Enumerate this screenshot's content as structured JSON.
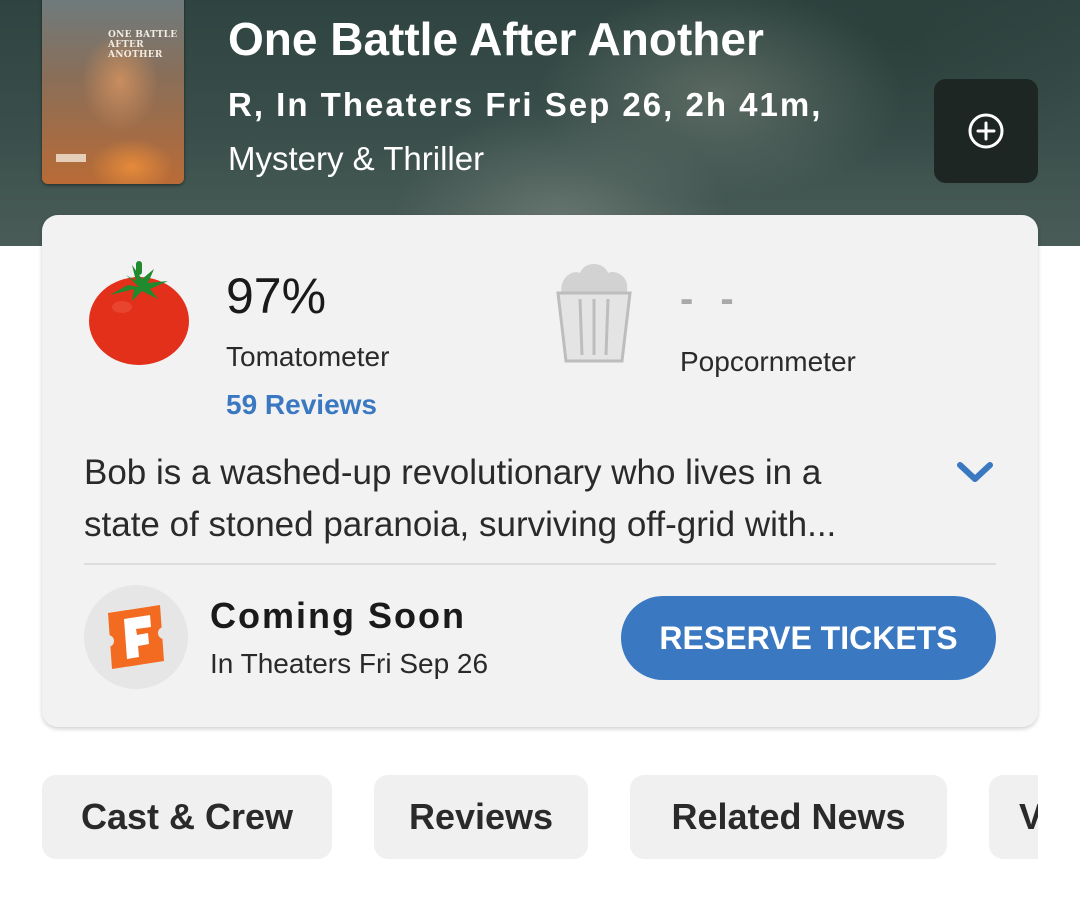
{
  "movie": {
    "poster_title": "ONE BATTLE AFTER ANOTHER",
    "title": "One Battle After Another",
    "meta": "R, In Theaters Fri Sep 26, 2h 41m,",
    "genre": "Mystery & Thriller",
    "add_icon": "plus-circle-icon"
  },
  "scores": {
    "tomatometer": {
      "value": "97%",
      "label": "Tomatometer",
      "reviews": "59 Reviews",
      "icon": "tomato-icon"
    },
    "popcornmeter": {
      "value": "- -",
      "label": "Popcornmeter",
      "icon": "popcorn-bucket-icon"
    }
  },
  "synopsis": {
    "line1": "Bob is a washed-up revolutionary who lives in a",
    "line2": "state of stoned paranoia, surviving off-grid with...",
    "expand_icon": "chevron-down-icon"
  },
  "tickets": {
    "status": "Coming Soon",
    "date": "In Theaters Fri Sep 26",
    "button": "RESERVE TICKETS",
    "provider_icon": "fandango-icon"
  },
  "tabs": [
    {
      "label": "Cast & Crew"
    },
    {
      "label": "Reviews"
    },
    {
      "label": "Related News"
    },
    {
      "label": "V"
    }
  ],
  "colors": {
    "accent": "#3a78c2",
    "tomato": "#e2301b",
    "fandango": "#f26b21",
    "card_bg": "#f2f2f2",
    "hero_bg": "#3a4f4b"
  }
}
